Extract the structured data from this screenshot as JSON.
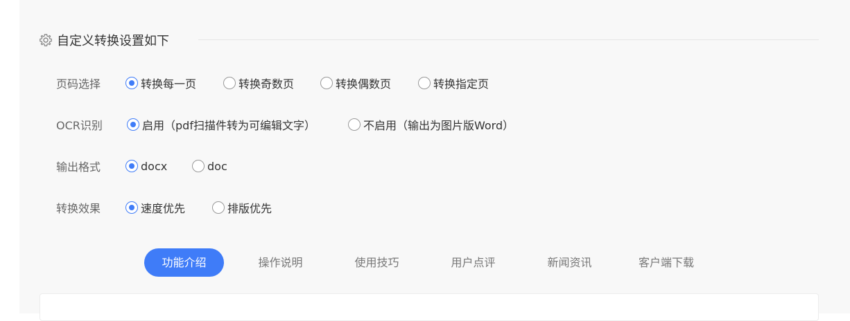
{
  "section": {
    "title": "自定义转换设置如下",
    "icon": "gear-icon"
  },
  "settings": [
    {
      "label": "页码选择",
      "options": [
        {
          "label": "转换每一页",
          "selected": true
        },
        {
          "label": "转换奇数页",
          "selected": false
        },
        {
          "label": "转换偶数页",
          "selected": false
        },
        {
          "label": "转换指定页",
          "selected": false
        }
      ]
    },
    {
      "label": "OCR识别",
      "options": [
        {
          "label": "启用（pdf扫描件转为可编辑文字）",
          "selected": true
        },
        {
          "label": "不启用（输出为图片版Word）",
          "selected": false
        }
      ]
    },
    {
      "label": "输出格式",
      "options": [
        {
          "label": "docx",
          "selected": true
        },
        {
          "label": "doc",
          "selected": false
        }
      ]
    },
    {
      "label": "转换效果",
      "options": [
        {
          "label": "速度优先",
          "selected": true
        },
        {
          "label": "排版优先",
          "selected": false
        }
      ]
    }
  ],
  "tabs": [
    {
      "label": "功能介绍",
      "active": true
    },
    {
      "label": "操作说明",
      "active": false
    },
    {
      "label": "使用技巧",
      "active": false
    },
    {
      "label": "用户点评",
      "active": false
    },
    {
      "label": "新闻资讯",
      "active": false
    },
    {
      "label": "客户端下载",
      "active": false
    }
  ],
  "colors": {
    "accent": "#3f7cf8",
    "panel_bg": "#f8f8f8"
  }
}
